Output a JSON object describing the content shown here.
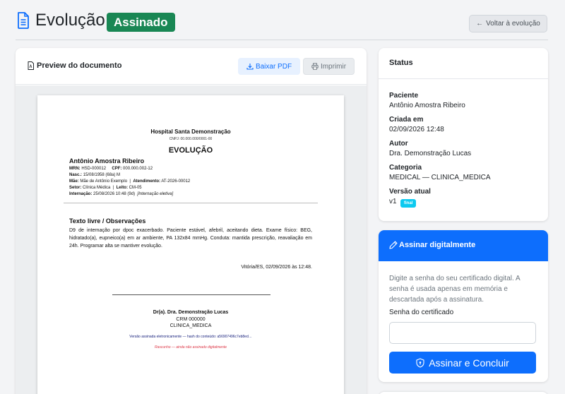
{
  "header": {
    "title": "Evolução",
    "badge": "Assinado",
    "back_label": "Voltar à evolução",
    "back_arrow": "←"
  },
  "preview": {
    "title": "Preview do documento",
    "download_label": "Baixar PDF",
    "print_label": "Imprimir"
  },
  "document": {
    "hospital": "Hospital Santa Demonstração",
    "cnpj": "CNPJ: 00.000.000/0001-00",
    "doc_type": "EVOLUÇÃO",
    "patient_name": "Antônio Amostra Ribeiro",
    "mrn_label": "MRN:",
    "mrn": "HSD-000012",
    "cpf_label": "CPF:",
    "cpf": "000.000.002-12",
    "nasc_label": "Nasc.:",
    "nasc": "15/08/1958 (68a) M",
    "mae_label": "Mãe:",
    "mae": "Mãe de Antônio Exemplo",
    "atend_label": "Atendimento:",
    "atend": "AT-2026-00012",
    "setor_label": "Setor:",
    "setor": "Clínica Médica",
    "leito_label": "Leito:",
    "leito": "CM-05",
    "intern_label": "Internação:",
    "intern": "25/08/2026 10:48 (9d)",
    "intern_type": "[Internação eletiva]",
    "separator": "|",
    "section_title": "Texto livre / Observações",
    "body": "D9 de internação por dpoc exacerbado. Paciente estável, afebril, aceitando dieta. Exame físico: BEG, hidratado(a), eupneico(a) em ar ambiente, PA 132x84 mmHg. Conduta: mantida prescrição, reavaliação em 24h. Programar alta se mantiver evolução.",
    "place_date": "Vitória/ES, 02/09/2026 às 12:48.",
    "signer": "Dr(a). Dra. Demonstração Lucas",
    "crm": "CRM 000000",
    "specialty": "CLINICA_MEDICA",
    "hash_note": "Versão assinada eletronicamente — hash do conteúdo: a56907496c7eb8ed…",
    "draft_note": "Rascunho — ainda não assinado digitalmente"
  },
  "status": {
    "title": "Status",
    "patient_label": "Paciente",
    "patient": "Antônio Amostra Ribeiro",
    "created_label": "Criada em",
    "created": "02/09/2026 12:48",
    "author_label": "Autor",
    "author": "Dra. Demonstração Lucas",
    "category_label": "Categoria",
    "category": "MEDICAL — CLINICA_MEDICA",
    "version_label": "Versão atual",
    "version": "v1",
    "version_badge": "final"
  },
  "sign": {
    "title": "Assinar digitalmente",
    "description": "Digite a senha do seu certificado digital. A senha é usada apenas em memória e descartada após a assinatura.",
    "password_label": "Senha do certificado",
    "password_value": "",
    "button_label": "Assinar e Concluir"
  },
  "colors": {
    "primary": "#0d6efd",
    "success": "#198754",
    "info": "#0dcaf0",
    "danger": "#dc3545"
  }
}
